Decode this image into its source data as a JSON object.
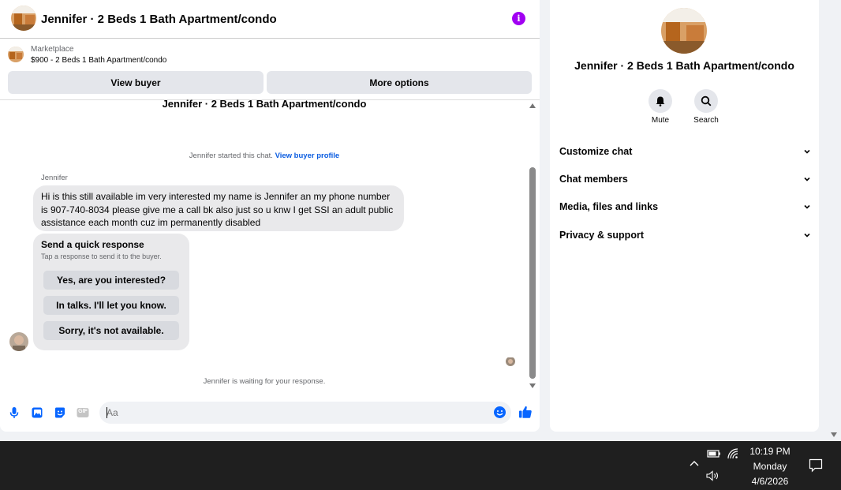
{
  "header": {
    "title": "Jennifer · 2 Beds 1 Bath Apartment/condo",
    "info_glyph": "i",
    "accent_color": "#a100f2"
  },
  "marketplace": {
    "label": "Marketplace",
    "listing": "$900 - 2 Beds 1 Bath Apartment/condo"
  },
  "actions": {
    "view_buyer": "View buyer",
    "more_options": "More options"
  },
  "thread": {
    "title": "Jennifer · 2 Beds 1 Bath Apartment/condo",
    "started_text": "Jennifer started this chat.",
    "started_link": "View buyer profile",
    "sender_name": "Jennifer",
    "message": "Hi is this still available im very interested my name is Jennifer an my phone number is 907-740-8034 please give me a call bk also just so u knw I get SSI an adult public assistance each month cuz im permanently disabled",
    "quick_response": {
      "title": "Send a quick response",
      "subtitle": "Tap a response to send it to the buyer.",
      "options": [
        "Yes, are you interested?",
        "In talks. I'll let you know.",
        "Sorry, it's not available."
      ]
    },
    "waiting_text": "Jennifer is waiting for your response."
  },
  "composer": {
    "placeholder": "Aa",
    "icons": [
      "microphone-icon",
      "photo-icon",
      "sticker-icon",
      "gif-icon",
      "emoji-icon",
      "thumbs-up-icon"
    ],
    "gif_label": "GIF",
    "brand_color": "#0866ff"
  },
  "details": {
    "title": "Jennifer · 2 Beds 1 Bath Apartment/condo",
    "mute_label": "Mute",
    "search_label": "Search",
    "sections": [
      "Customize chat",
      "Chat members",
      "Media, files and links",
      "Privacy & support"
    ]
  },
  "taskbar": {
    "time": "10:19 PM",
    "day": "Monday",
    "date": "4/6/2026"
  }
}
